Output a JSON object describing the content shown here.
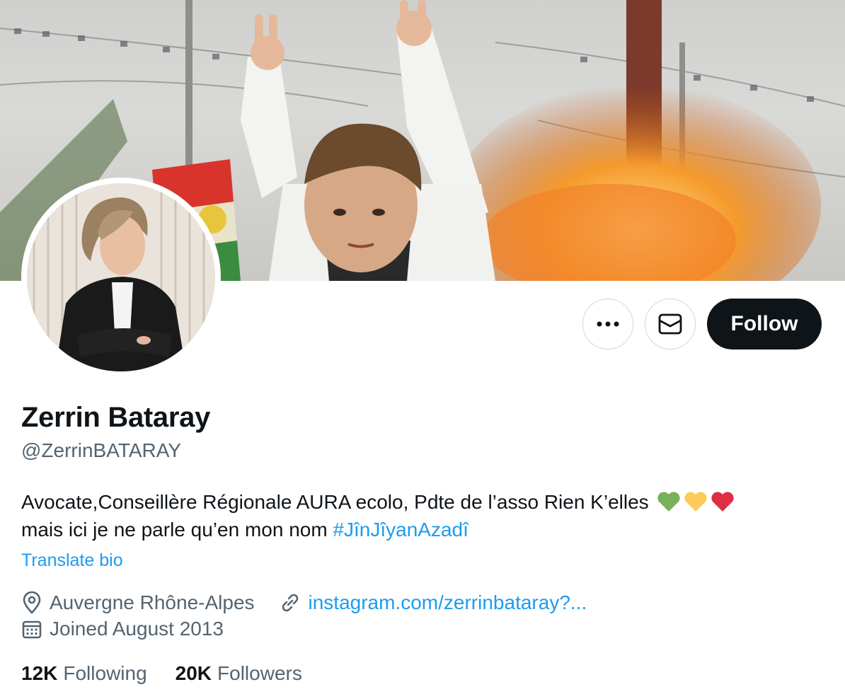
{
  "profile": {
    "name": "Zerrin Bataray",
    "handle": "@ZerrinBATARAY",
    "bio_text": "Avocate,Conseillère Régionale AURA ecolo, Pdte de l’asso Rien K’elles",
    "bio_line2": "mais ici je ne parle qu’en mon nom",
    "bio_hashtag": "#JînJîyanAzadî",
    "translate_label": "Translate bio",
    "location": "Auvergne Rhône-Alpes",
    "website": "instagram.com/zerrinbataray?...",
    "joined": "Joined August 2013"
  },
  "actions": {
    "follow_label": "Follow",
    "more_icon": "more-icon",
    "message_icon": "envelope-icon"
  },
  "stats": {
    "following_count": "12K",
    "following_label": "Following",
    "followers_count": "20K",
    "followers_label": "Followers"
  },
  "colors": {
    "accent": "#1d9bf0",
    "text": "#0f1419",
    "secondary": "#536471",
    "heart_green": "#78b159",
    "heart_yellow": "#fdcb58",
    "heart_red": "#dd2e44"
  }
}
